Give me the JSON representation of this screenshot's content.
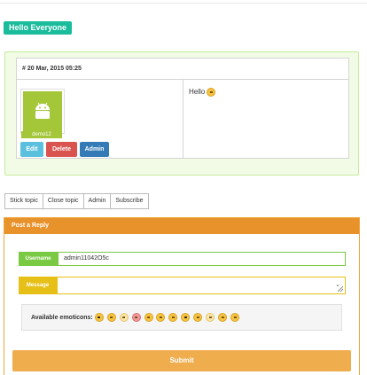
{
  "page": {
    "title_badge": "Hello Everyone"
  },
  "post": {
    "date": "# 20 Mar, 2015 05:25",
    "username": "demo12",
    "buttons": {
      "edit": "Edit",
      "delete": "Delete",
      "admin": "Admin"
    },
    "message": "Hello"
  },
  "topic_actions": [
    "Stick topic",
    "Close topic",
    "Admin",
    "Subscribe"
  ],
  "reply": {
    "header": "Post a Reply",
    "username_label": "Username",
    "username_value": "admin11042O5c",
    "message_label": "Message",
    "message_value": "",
    "emoticons_label": "Available emoticons:",
    "emoticons": [
      "cool-face",
      "smile-face",
      "pale-face",
      "red-face",
      "smile-face",
      "smile-face",
      "smile-face",
      "cool-face",
      "smile-face",
      "pale-face",
      "smile-face",
      "smile-face"
    ],
    "submit_label": "Submit"
  },
  "colors": {
    "title_badge": "#1abc9c",
    "post_panel_bg": "#f1fbe6",
    "edit": "#5bc0de",
    "delete": "#d9534f",
    "admin": "#337ab7",
    "reply_header": "#e8922c",
    "username_label": "#7ac943",
    "message_label": "#e6c016",
    "submit": "#f0ad4e"
  }
}
